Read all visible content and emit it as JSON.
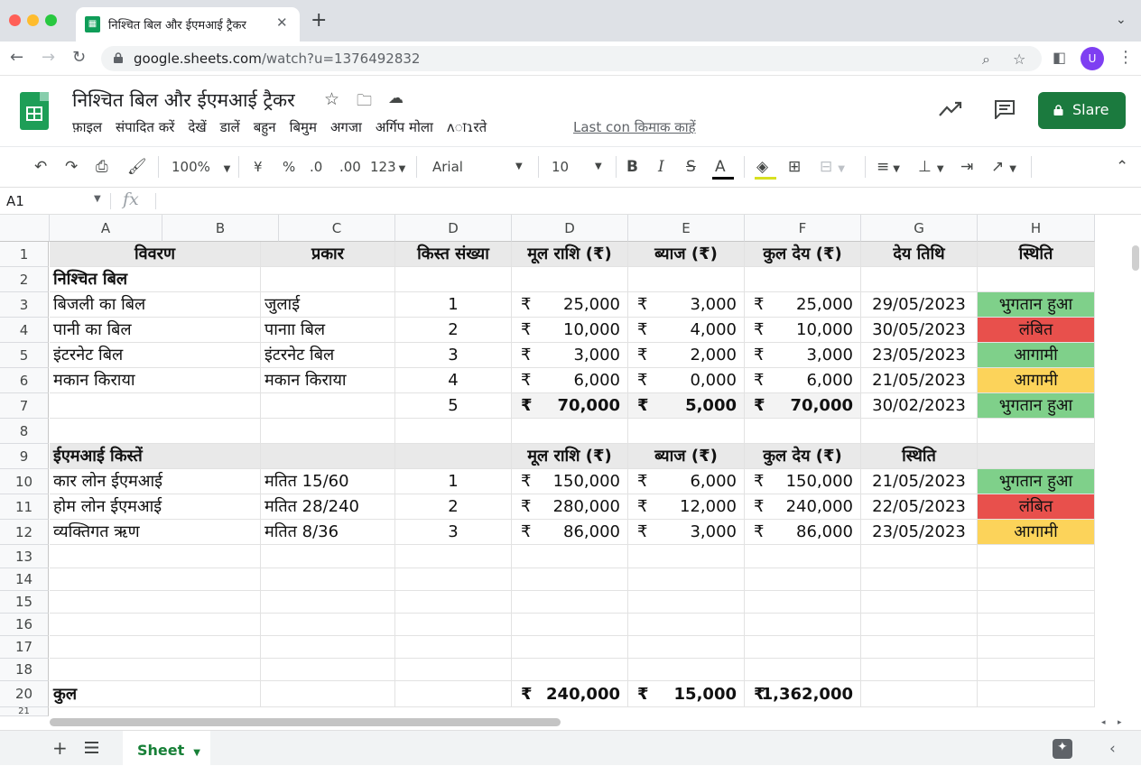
{
  "browser": {
    "tab_title": "निश्चित बिल और ईएमआई ट्रैकर",
    "url_host": "google.sheets.com",
    "url_path": "/watch?u=1376492832",
    "avatar_letter": "U",
    "accent_color": "#7e3ff2"
  },
  "app": {
    "doc_title": "निश्चित बिल और ईएमआई ट्रैकर",
    "menus": [
      "फ़ाइल",
      "संपादित करें",
      "देखें",
      "डालें",
      "बहुन",
      "बिमुम",
      "अगजा",
      "अर्गिप मोला",
      "ʌाɿरते"
    ],
    "last_edit": "Last con किमाक काहें",
    "share_label": "Slare",
    "share_color": "#1b7a3e"
  },
  "toolbar": {
    "zoom": "100%",
    "currency": "¥",
    "percent": "%",
    "dec_less": ".0",
    "dec_more": ".00",
    "format_more": "123",
    "font": "Arial",
    "font_size": "10",
    "bold": "B",
    "italic": "I",
    "strike": "S",
    "text_color": "A"
  },
  "formula_bar": {
    "name_box": "A1",
    "fx": "fx",
    "value": ""
  },
  "columns": [
    "A",
    "B",
    "C",
    "D",
    "D",
    "E",
    "F",
    "G",
    "H"
  ],
  "rows": [
    "1",
    "2",
    "3",
    "4",
    "5",
    "6",
    "7",
    "8",
    "9",
    "10",
    "11",
    "12",
    "13",
    "14",
    "15",
    "16",
    "17",
    "18",
    "20",
    "21"
  ],
  "sheet": {
    "header": [
      "विवरण",
      "प्रकार",
      "किस्त संख्या",
      "मूल राशि (₹)",
      "ब्याज (₹)",
      "कुल देय (₹)",
      "देय तिथि",
      "स्थिति"
    ],
    "section1_title": "निश्चित बिल",
    "bills": [
      {
        "desc": "बिजली का बिल",
        "type": "जुलाई",
        "no": "1",
        "principal": "25,000",
        "interest": "3,000",
        "total": "25,000",
        "due": "29/05/2023",
        "status": "भुगतान हुआ"
      },
      {
        "desc": "पानी का बिल",
        "type": "पानाा बिल",
        "no": "2",
        "principal": "10,000",
        "interest": "4,000",
        "total": "10,000",
        "due": "30/05/2023",
        "status": "लंबित"
      },
      {
        "desc": "इंटरनेट बिल",
        "type": "इंटरनेट बिल",
        "no": "3",
        "principal": "3,000",
        "interest": "2,000",
        "total": "3,000",
        "due": "23/05/2023",
        "status": "आगामी"
      },
      {
        "desc": "मकान किराया",
        "type": "मकान किराया",
        "no": "4",
        "principal": "6,000",
        "interest": "0,000",
        "total": "6,000",
        "due": "21/05/2023",
        "status": "आगामी"
      }
    ],
    "bills_total": {
      "no": "5",
      "principal": "70,000",
      "interest": "5,000",
      "total": "70,000",
      "due": "30/02/2023",
      "status": "भुगतान हुआ"
    },
    "section2_title": "ईएमआई किस्तें",
    "section2_header": [
      "मूल राशि (₹)",
      "ब्याज (₹)",
      "कुल देय (₹)",
      "स्थिति"
    ],
    "emis": [
      {
        "desc": "कार लोन ईएमआई",
        "type": "मतित 15/60",
        "no": "1",
        "principal": "150,000",
        "interest": "6,000",
        "total": "150,000",
        "due": "21/05/2023",
        "status": "भुगतान हुआ"
      },
      {
        "desc": "होम लोन ईएमआई",
        "type": "मतित 28/240",
        "no": "2",
        "principal": "280,000",
        "interest": "12,000",
        "total": "240,000",
        "due": "22/05/2023",
        "status": "लंबित"
      },
      {
        "desc": "व्यक्तिगत ऋण",
        "type": "मतित 8/36",
        "no": "3",
        "principal": "86,000",
        "interest": "3,000",
        "total": "86,000",
        "due": "23/05/2023",
        "status": "आगामी"
      }
    ],
    "grand_total": {
      "label": "कुल",
      "principal": "240,000",
      "interest": "15,000",
      "total": "1,362,000"
    },
    "currency_symbol": "₹",
    "status_colors": {
      "paid": "#7fd08a",
      "pending": "#e8504c",
      "upcoming": "#fcd35a"
    }
  },
  "sheet_tab": "Sheet"
}
